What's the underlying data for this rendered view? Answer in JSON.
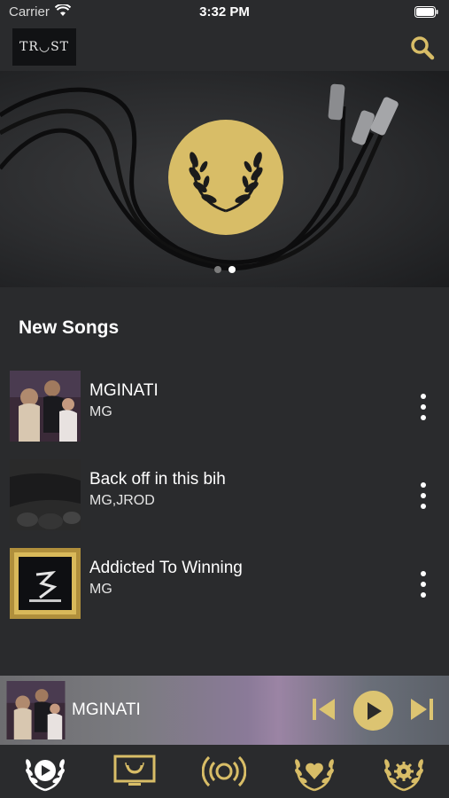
{
  "status_bar": {
    "carrier": "Carrier",
    "time": "3:32 PM"
  },
  "header": {
    "logo_text": "TR◡ST"
  },
  "banner": {
    "active_slide": 2,
    "slide_count": 2
  },
  "section": {
    "title": "New Songs"
  },
  "songs": [
    {
      "title": "MGINATI",
      "artist": "MG"
    },
    {
      "title": "Back off in this bih",
      "artist": "MG,JROD"
    },
    {
      "title": "Addicted To Winning",
      "artist": "MG"
    }
  ],
  "player": {
    "title": "MGINATI"
  },
  "colors": {
    "gold": "#d8bd67",
    "background": "#2a2b2d"
  },
  "tabs": [
    {
      "icon": "play-laurel-icon"
    },
    {
      "icon": "tv-laurel-icon"
    },
    {
      "icon": "broadcast-icon"
    },
    {
      "icon": "heart-laurel-icon"
    },
    {
      "icon": "gear-laurel-icon"
    }
  ]
}
